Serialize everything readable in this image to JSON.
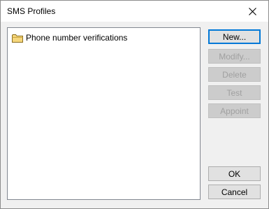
{
  "window": {
    "title": "SMS Profiles"
  },
  "titlebar": {
    "close_icon": "close-icon"
  },
  "list": {
    "items": [
      {
        "label": "Phone number verifications",
        "icon": "folder-icon"
      }
    ]
  },
  "buttons": {
    "new": "New...",
    "modify": "Modify...",
    "delete": "Delete",
    "test": "Test",
    "appoint": "Appoint",
    "ok": "OK",
    "cancel": "Cancel"
  }
}
